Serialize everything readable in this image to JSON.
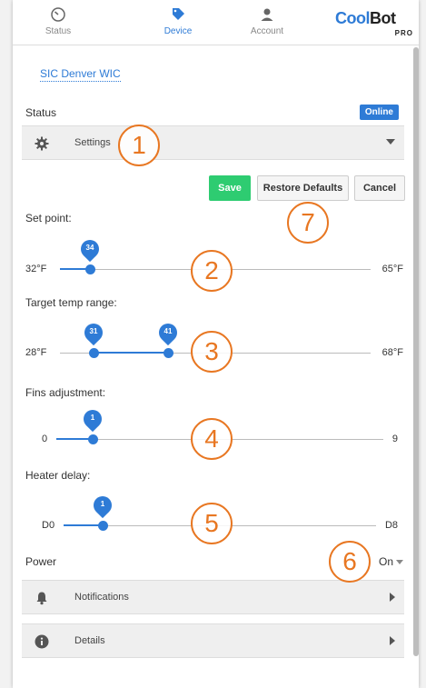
{
  "nav": {
    "status_label": "Status",
    "device_label": "Device",
    "account_label": "Account",
    "logo": {
      "cool": "Cool",
      "bot": "Bot",
      "pro": "PRO"
    }
  },
  "device": {
    "name": "SIC Denver WIC",
    "status_label": "Status",
    "status_badge": "Online"
  },
  "sections": {
    "settings": "Settings",
    "notifications": "Notifications",
    "details": "Details"
  },
  "buttons": {
    "save": "Save",
    "restore": "Restore Defaults",
    "cancel": "Cancel"
  },
  "fields": {
    "set_point": {
      "label": "Set point:",
      "min_label": "32°F",
      "max_label": "65°F",
      "min": 32,
      "max": 65,
      "value": "34"
    },
    "target_range": {
      "label": "Target temp range:",
      "min_label": "28°F",
      "max_label": "68°F",
      "min": 28,
      "max": 68,
      "low": "31",
      "high": "41"
    },
    "fins": {
      "label": "Fins adjustment:",
      "min_label": "0",
      "max_label": "9",
      "min": 0,
      "max": 9,
      "value": "1"
    },
    "heater": {
      "label": "Heater delay:",
      "min_label": "D0",
      "max_label": "D8",
      "min": 0,
      "max": 8,
      "value": "1"
    },
    "power": {
      "label": "Power",
      "value": "On"
    }
  },
  "callouts": [
    "1",
    "2",
    "3",
    "4",
    "5",
    "6",
    "7"
  ],
  "colors": {
    "accent": "#2e7bd6",
    "save": "#2ecc71",
    "callout": "#e87722"
  }
}
